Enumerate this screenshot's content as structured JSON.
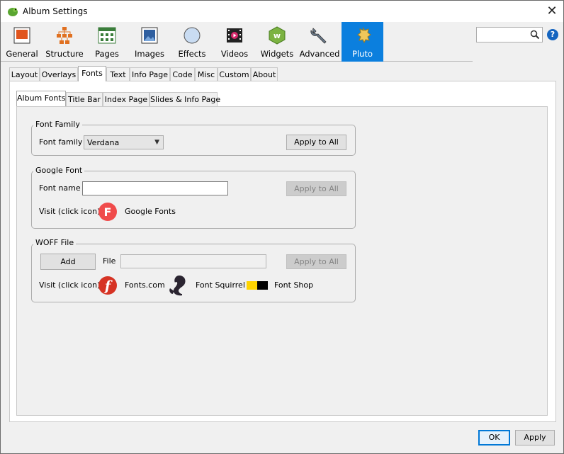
{
  "window": {
    "title": "Album Settings",
    "close_symbol": "✕"
  },
  "toolbar": {
    "items": [
      {
        "label": "General",
        "icon": "general-icon"
      },
      {
        "label": "Structure",
        "icon": "structure-icon"
      },
      {
        "label": "Pages",
        "icon": "pages-icon"
      },
      {
        "label": "Images",
        "icon": "images-icon"
      },
      {
        "label": "Effects",
        "icon": "effects-icon"
      },
      {
        "label": "Videos",
        "icon": "videos-icon"
      },
      {
        "label": "Widgets",
        "icon": "widgets-icon"
      },
      {
        "label": "Advanced",
        "icon": "advanced-icon"
      },
      {
        "label": "Pluto",
        "icon": "pluto-icon",
        "active": true
      }
    ],
    "search": {
      "value": "",
      "placeholder": ""
    },
    "help_symbol": "?"
  },
  "tabs": {
    "items": [
      "Layout",
      "Overlays",
      "Fonts",
      "Text",
      "Info Page",
      "Code",
      "Misc",
      "Custom",
      "About"
    ],
    "selected": "Fonts"
  },
  "subtabs": {
    "items": [
      "Album Fonts",
      "Title Bar",
      "Index Page",
      "Slides & Info Page"
    ],
    "selected": "Album Fonts"
  },
  "font_family": {
    "group_title": "Font Family",
    "label": "Font family",
    "value": "Verdana",
    "apply": "Apply to All"
  },
  "google_font": {
    "group_title": "Google Font",
    "name_label": "Font name",
    "name_value": "",
    "apply": "Apply to All",
    "visit_label": "Visit (click icon)",
    "link_label": "Google Fonts"
  },
  "woff": {
    "group_title": "WOFF File",
    "add": "Add",
    "file_label": "File",
    "file_value": "",
    "apply": "Apply to All",
    "visit_label": "Visit (click icon)",
    "links": [
      "Fonts.com",
      "Font Squirrel",
      "Font Shop"
    ]
  },
  "footer": {
    "ok": "OK",
    "apply": "Apply"
  },
  "colors": {
    "accent": "#0b7fde",
    "google_red": "#f04b4b",
    "fontscom_red": "#d63324",
    "fontshop_yellow": "#ffd400"
  }
}
